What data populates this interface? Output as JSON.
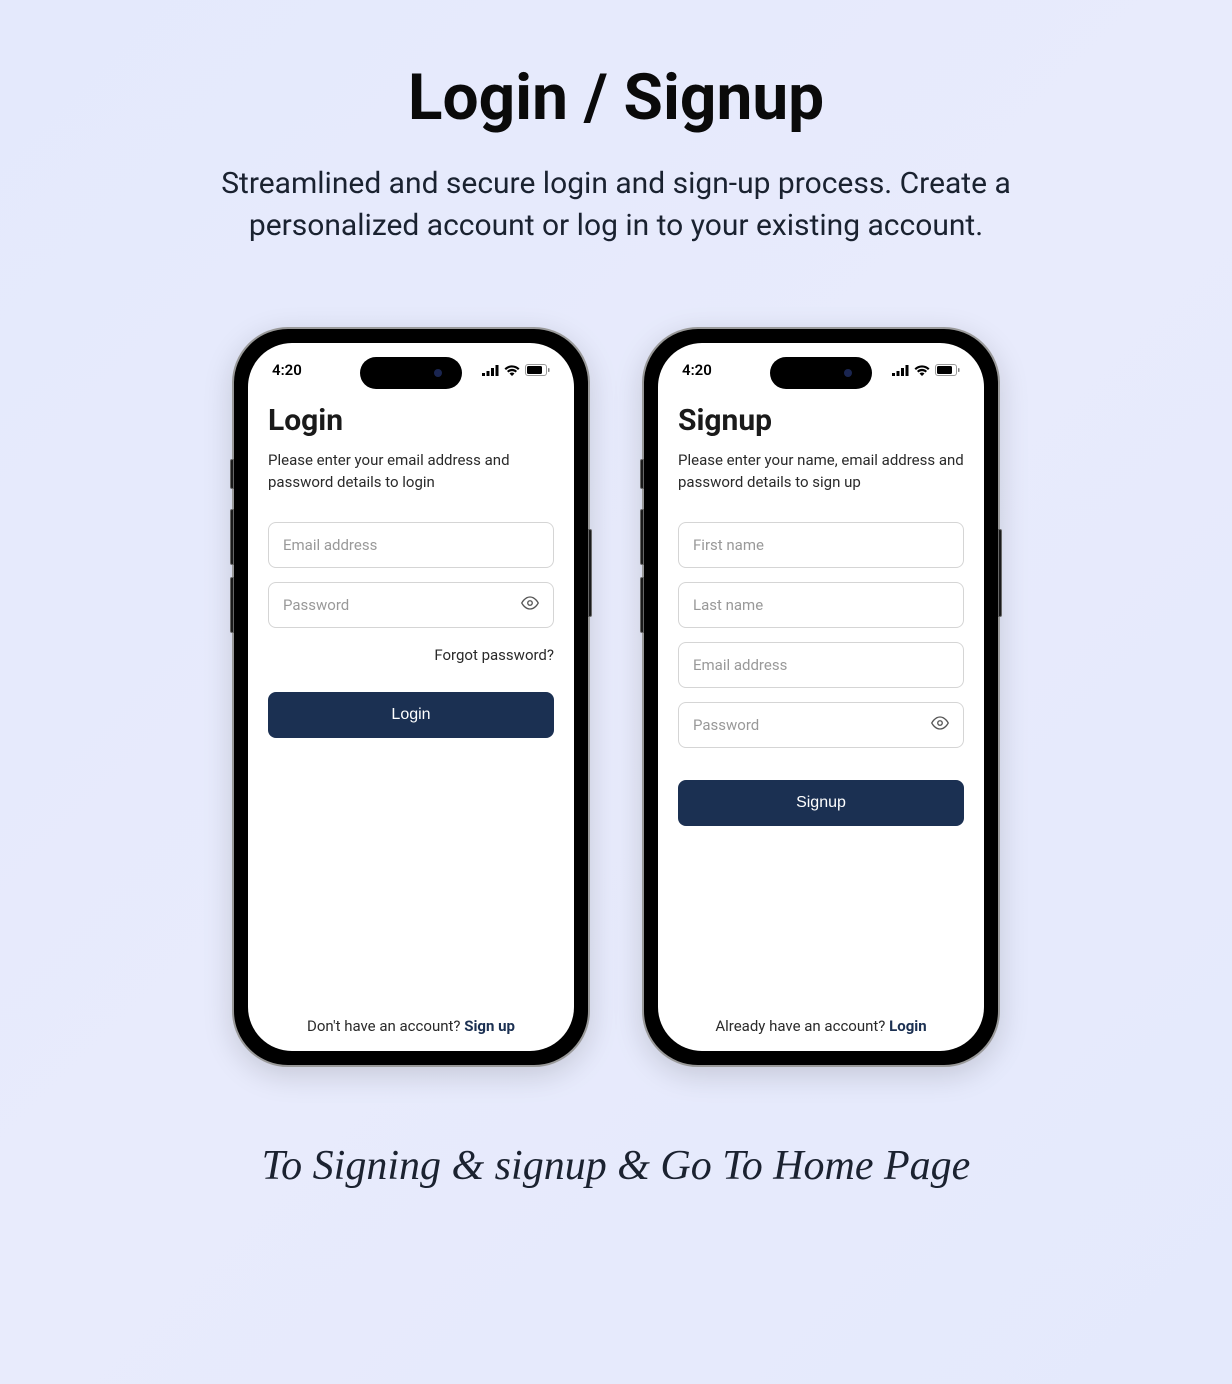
{
  "page": {
    "title": "Login / Signup",
    "subtitle": "Streamlined and secure login and sign-up process. Create a personalized account or log in to your existing account.",
    "footer": "To Signing & signup & Go To Home Page"
  },
  "status_bar": {
    "time": "4:20"
  },
  "login_screen": {
    "title": "Login",
    "description": "Please enter your email address and password details to login",
    "email_placeholder": "Email address",
    "password_placeholder": "Password",
    "forgot_link": "Forgot password?",
    "button_label": "Login",
    "bottom_text": "Don't have an account? ",
    "bottom_action": "Sign up"
  },
  "signup_screen": {
    "title": "Signup",
    "description": "Please enter your name, email address and password details to sign up",
    "firstname_placeholder": "First name",
    "lastname_placeholder": "Last name",
    "email_placeholder": "Email address",
    "password_placeholder": "Password",
    "button_label": "Signup",
    "bottom_text": "Already have an account? ",
    "bottom_action": "Login"
  },
  "colors": {
    "primary": "#1b3052",
    "background": "#e4e9fc"
  }
}
